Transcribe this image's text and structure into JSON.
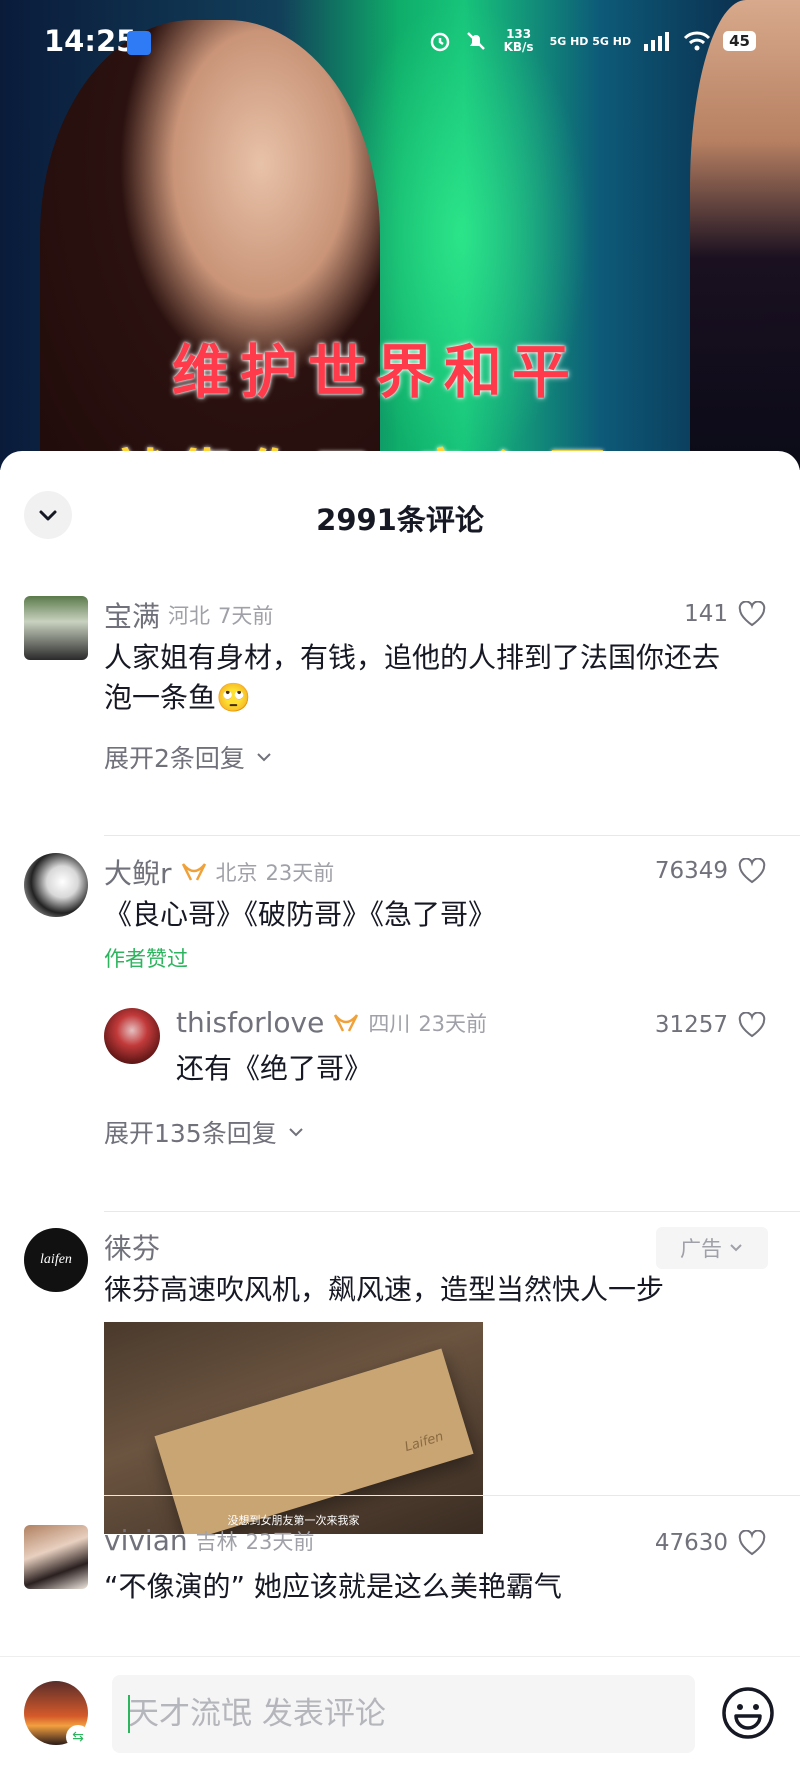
{
  "status": {
    "time": "14:25",
    "speed": "133 KB/s",
    "network": "5G HD 5G HD",
    "battery": "45"
  },
  "video": {
    "caption_line1": "维护世界和平",
    "caption_line2": "就靠你了 良心哥"
  },
  "sheet": {
    "title": "2991条评论"
  },
  "comments": [
    {
      "user": "宝满",
      "location": "河北",
      "time": "7天前",
      "likes": "141",
      "text_line1": "人家姐有身材，有钱，追他的人排到了法国你还去",
      "text_line2": "泡一条鱼🙄",
      "expand": "展开2条回复"
    },
    {
      "user": "大鲵r",
      "location": "北京",
      "time": "23天前",
      "likes": "76349",
      "text": "《良心哥》《破防哥》《急了哥》",
      "author_liked": "作者赞过",
      "reply": {
        "user": "thisforlove",
        "location": "四川",
        "time": "23天前",
        "likes": "31257",
        "text": "还有《绝了哥》"
      },
      "expand": "展开135条回复"
    },
    {
      "user": "徕芬",
      "avatar_text": "laifen",
      "ad_tag": "广告",
      "text": "徕芬高速吹风机，飙风速，造型当然快人一步",
      "image_caption": "没想到女朋友第一次来我家",
      "box_brand": "Laifen"
    },
    {
      "user": "vivian",
      "location": "吉林",
      "time": "23天前",
      "likes": "47630",
      "text": "“不像演的” 她应该就是这么美艳霸气"
    }
  ],
  "input": {
    "placeholder": "天才流氓 发表评论"
  }
}
